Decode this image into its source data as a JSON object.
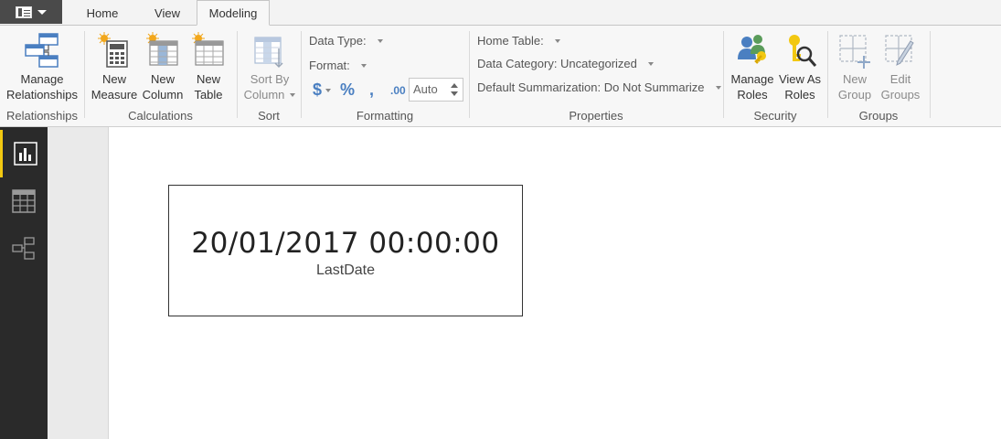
{
  "tabs": [
    {
      "label": "Home"
    },
    {
      "label": "View"
    },
    {
      "label": "Modeling"
    }
  ],
  "ribbon": {
    "relationships": {
      "button_line1": "Manage",
      "button_line2": "Relationships",
      "group": "Relationships"
    },
    "calculations": {
      "new_measure": [
        "New",
        "Measure"
      ],
      "new_column": [
        "New",
        "Column"
      ],
      "new_table": [
        "New",
        "Table"
      ],
      "group": "Calculations"
    },
    "sort": {
      "button_line1": "Sort By",
      "button_line2": "Column",
      "group": "Sort"
    },
    "formatting": {
      "data_type": "Data Type:",
      "format": "Format:",
      "currency": "$",
      "percent": "%",
      "comma": ",",
      "decimal": ".00",
      "auto": "Auto",
      "group": "Formatting"
    },
    "properties": {
      "home_table": "Home Table:",
      "data_category": "Data Category: Uncategorized",
      "default_summarization": "Default Summarization: Do Not Summarize",
      "group": "Properties"
    },
    "security": {
      "manage_roles": [
        "Manage",
        "Roles"
      ],
      "view_as_roles": [
        "View As",
        "Roles"
      ],
      "group": "Security"
    },
    "groups": {
      "new_group": [
        "New",
        "Group"
      ],
      "edit_groups": [
        "Edit",
        "Groups"
      ],
      "group": "Groups"
    }
  },
  "left_nav": {
    "items": [
      {
        "icon": "report-view-icon"
      },
      {
        "icon": "data-view-icon"
      },
      {
        "icon": "relationships-view-icon"
      }
    ]
  },
  "card": {
    "value": "20/01/2017 00:00:00",
    "label": "LastDate"
  },
  "colors": {
    "accent": "#f2c811",
    "nav_bg": "#2a2a2a",
    "icon_blue": "#4a7fc1"
  }
}
